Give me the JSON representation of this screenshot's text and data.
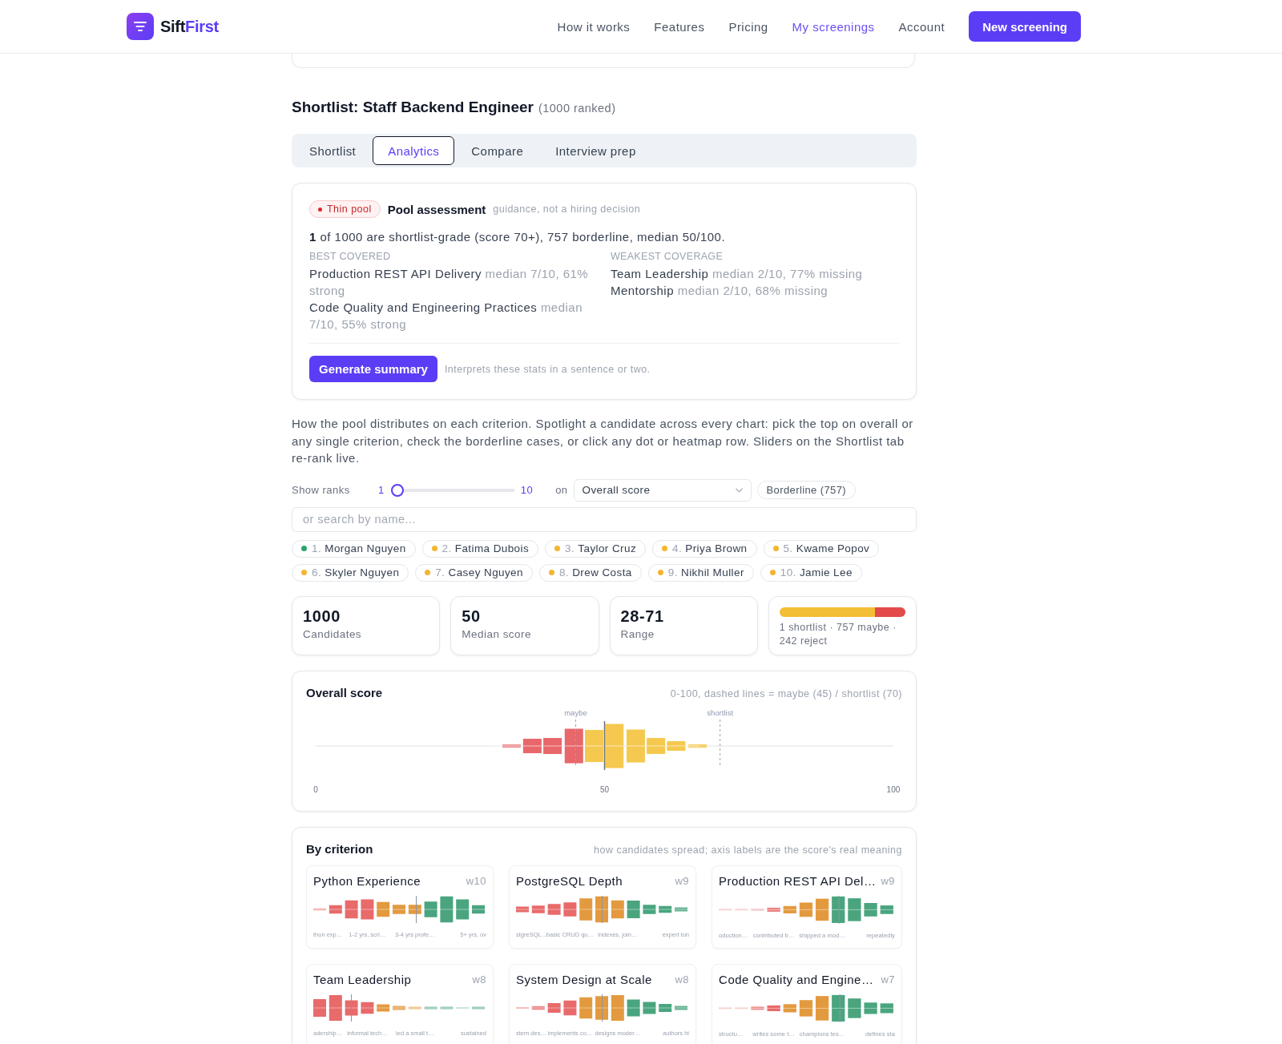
{
  "header": {
    "logo_text": "Sift",
    "logo_accent": "First",
    "nav": [
      {
        "label": "How it works",
        "selected": false
      },
      {
        "label": "Features",
        "selected": false
      },
      {
        "label": "Pricing",
        "selected": false
      },
      {
        "label": "My screenings",
        "selected": true
      },
      {
        "label": "Account",
        "selected": false
      }
    ],
    "cta": "New screening"
  },
  "page": {
    "title": "Shortlist: Staff Backend Engineer",
    "count": "(1000 ranked)"
  },
  "tabs": [
    {
      "label": "Shortlist",
      "selected": false
    },
    {
      "label": "Analytics",
      "selected": true
    },
    {
      "label": "Compare",
      "selected": false
    },
    {
      "label": "Interview prep",
      "selected": false
    }
  ],
  "assessment": {
    "badge": "Thin pool",
    "title": "Pool assessment",
    "note": "guidance, not a hiring decision",
    "summary": "**1** of 1000 are shortlist-grade (score 70+), 757 borderline, median 50/100.",
    "columns": [
      {
        "heading": "BEST COVERED",
        "items": [
          {
            "name": "Production REST API Delivery",
            "detail": "median 7/10, 61% strong"
          },
          {
            "name": "Code Quality and Engineering Practices",
            "detail": "median 7/10, 55% strong"
          }
        ]
      },
      {
        "heading": "WEAKEST COVERAGE",
        "items": [
          {
            "name": "Team Leadership",
            "detail": "median 2/10, 77% missing"
          },
          {
            "name": "Mentorship",
            "detail": "median 2/10, 68% missing"
          }
        ]
      }
    ],
    "button": "Generate summary",
    "hint": "Interprets these stats in a sentence or two."
  },
  "intro": "How the pool distributes on each criterion. Spotlight a candidate across every chart: pick the top on overall or any single criterion, check the borderline cases, or click any dot or heatmap row. Sliders on the Shortlist tab re-rank live.",
  "controls": {
    "label": "Show ranks",
    "slider": {
      "min": "1",
      "max": "10",
      "level": 0
    },
    "on": "on",
    "dropdown": "Overall score",
    "filter": "Borderline (757)",
    "search_placeholder": "or search by name..."
  },
  "candidates": [
    {
      "rank": "1.",
      "name": "Morgan Nguyen",
      "color": "#2ea36b"
    },
    {
      "rank": "2.",
      "name": "Fatima Dubois",
      "color": "#f2b630"
    },
    {
      "rank": "3.",
      "name": "Taylor Cruz",
      "color": "#f2b630"
    },
    {
      "rank": "4.",
      "name": "Priya Brown",
      "color": "#f2b630"
    },
    {
      "rank": "5.",
      "name": "Kwame Popov",
      "color": "#f2b630"
    },
    {
      "rank": "6.",
      "name": "Skyler Nguyen",
      "color": "#f2b630"
    },
    {
      "rank": "7.",
      "name": "Casey Nguyen",
      "color": "#f2b630"
    },
    {
      "rank": "8.",
      "name": "Drew Costa",
      "color": "#f2b630"
    },
    {
      "rank": "9.",
      "name": "Nikhil Muller",
      "color": "#f2b630"
    },
    {
      "rank": "10.",
      "name": "Jamie Lee",
      "color": "#f2b630"
    }
  ],
  "stats": [
    {
      "kind": "number",
      "value": "1000",
      "label": "Candidates"
    },
    {
      "kind": "number",
      "value": "50",
      "label": "Median score"
    },
    {
      "kind": "number",
      "value": "28-71",
      "label": "Range"
    },
    {
      "kind": "breakdown",
      "segments": [
        {
          "color": "#f2be35",
          "level": 0.757
        },
        {
          "color": "#e34b4b",
          "level": 0.242
        }
      ],
      "caption": "1 shortlist · 757 maybe · 242 reject"
    }
  ],
  "overall": {
    "title": "Overall score",
    "note": "0-100, dashed lines = maybe (45) / shortlist (70)",
    "markers": [
      {
        "label": "maybe"
      },
      {
        "label": "shortlist"
      }
    ],
    "ticks": [
      "0",
      "50",
      "100"
    ]
  },
  "criteria": {
    "title": "By criterion",
    "note": "how candidates spread; axis labels are the score's real meaning",
    "items": [
      {
        "name": "Python Experience",
        "weight": "w10",
        "labels": [
          "thon exp…",
          "1-2 yrs, scri…",
          "3-4 yrs profe…",
          "5+ yrs, ov"
        ]
      },
      {
        "name": "PostgreSQL Depth",
        "weight": "w9",
        "labels": [
          "stgreSQL…",
          "basic CRUD qu…",
          "indexes, join…",
          "expert tun"
        ]
      },
      {
        "name": "Production REST API Del…",
        "weight": "w9",
        "labels": [
          "oduction…",
          "contributed b…",
          "shipped a mod…",
          "repeatedly"
        ]
      },
      {
        "name": "Team Leadership",
        "weight": "w8",
        "labels": [
          "adership…",
          "informal tech…",
          "led a small t…",
          "sustained"
        ]
      },
      {
        "name": "System Design at Scale",
        "weight": "w8",
        "labels": [
          "stem des…",
          "implements co…",
          "designs moder…",
          "authors hi"
        ]
      },
      {
        "name": "Code Quality and Engine…",
        "weight": "w7",
        "labels": [
          "structu…",
          "writes some t…",
          "champions tes…",
          "defines sta"
        ]
      }
    ]
  }
}
